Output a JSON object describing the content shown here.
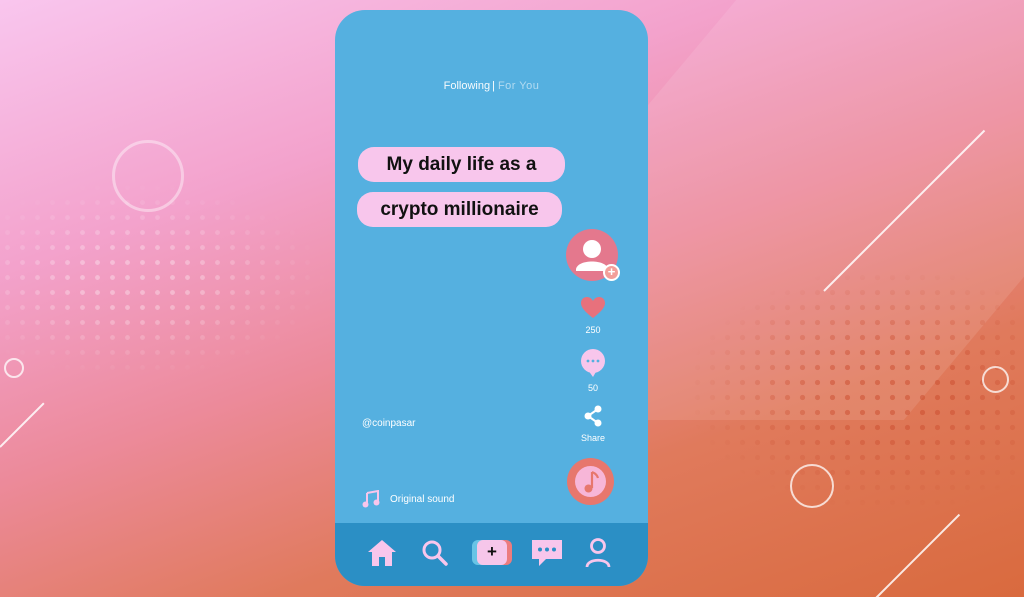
{
  "feed_tabs": {
    "following": "Following",
    "separator": "|",
    "for_you": "For You"
  },
  "caption": {
    "line1": "My daily life as a",
    "line2": "crypto millionaire"
  },
  "actions": {
    "likes": "250",
    "comments": "50",
    "share": "Share"
  },
  "username": "@coinpasar",
  "sound": "Original sound",
  "nav": {
    "items": [
      "home-icon",
      "search-icon",
      "create-icon",
      "inbox-icon",
      "profile-icon"
    ],
    "create_symbol": "+"
  },
  "colors": {
    "phone": "#55b0e0",
    "nav_bar": "#2b8fc5",
    "pill": "#f8c6ec",
    "accent": "#e4788d"
  }
}
